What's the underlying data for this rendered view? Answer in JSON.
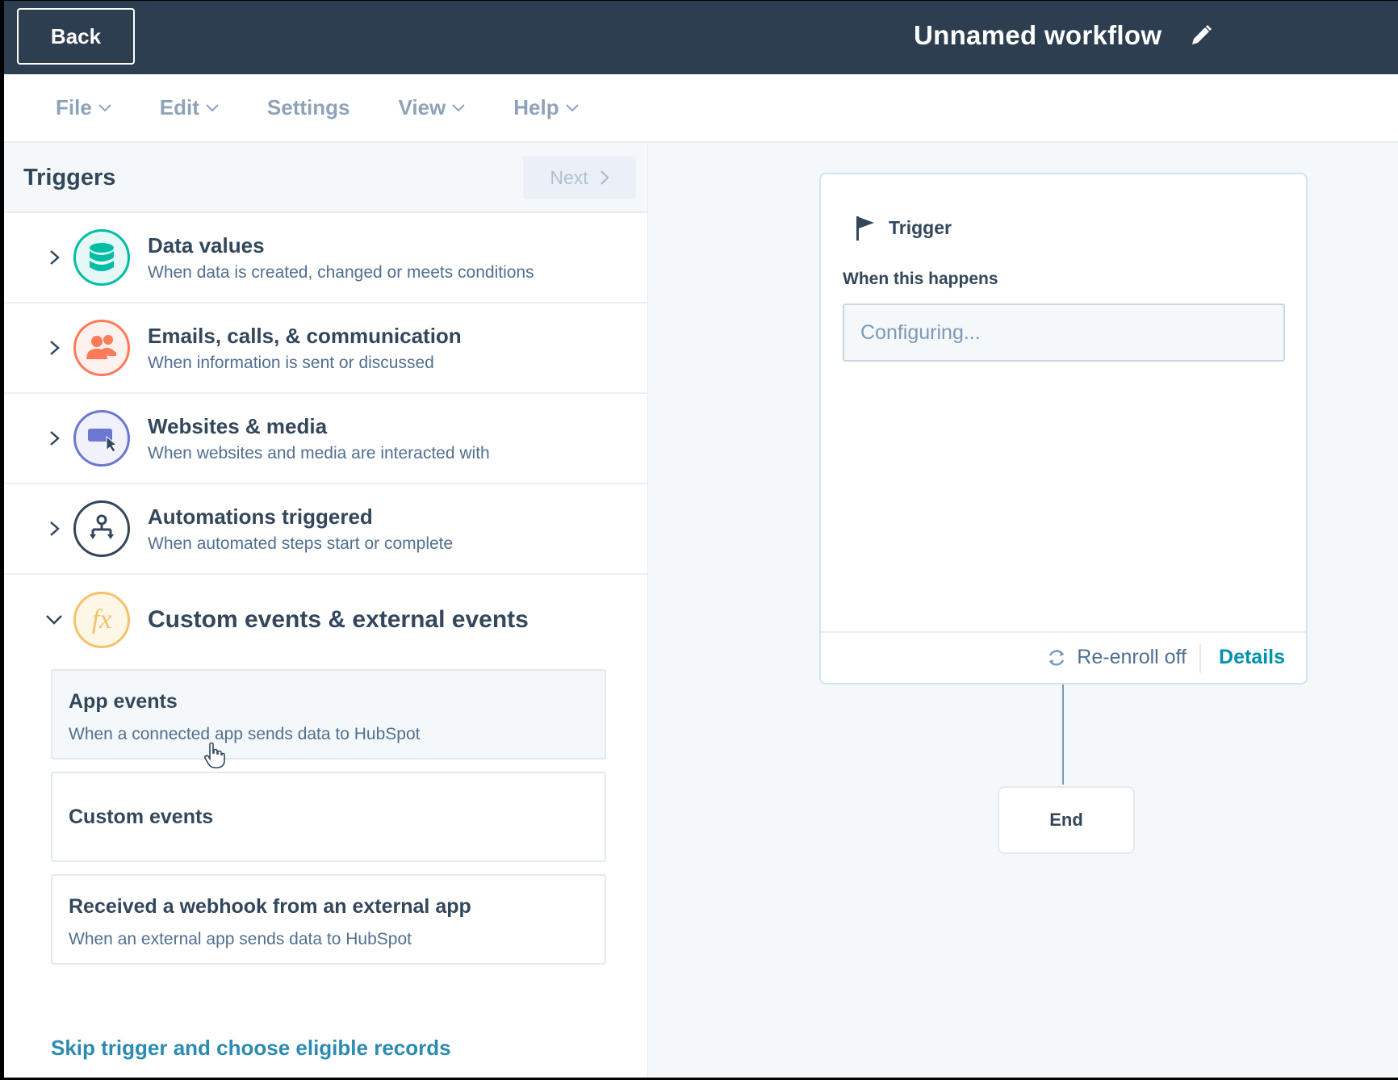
{
  "header": {
    "back_label": "Back",
    "workflow_title": "Unnamed workflow",
    "edit_icon": "pencil-icon"
  },
  "menu": {
    "items": [
      {
        "label": "File",
        "has_dropdown": true
      },
      {
        "label": "Edit",
        "has_dropdown": true
      },
      {
        "label": "Settings",
        "has_dropdown": false
      },
      {
        "label": "View",
        "has_dropdown": true
      },
      {
        "label": "Help",
        "has_dropdown": true
      }
    ]
  },
  "panel": {
    "title": "Triggers",
    "next_label": "Next",
    "categories": [
      {
        "title": "Data values",
        "desc": "When data is created, changed or meets conditions",
        "icon": "database-icon",
        "color": "#00bda5"
      },
      {
        "title": "Emails, calls, & communication",
        "desc": "When information is sent or discussed",
        "icon": "people-icon",
        "color": "#ff7a59"
      },
      {
        "title": "Websites & media",
        "desc": "When websites and media are interacted with",
        "icon": "web-click-icon",
        "color": "#6a78d1"
      },
      {
        "title": "Automations triggered",
        "desc": "When automated steps start or complete",
        "icon": "workflow-icon",
        "color": "#33475b"
      }
    ],
    "open_category": {
      "title": "Custom events & external events",
      "icon_text": "fx",
      "icon": "function-icon",
      "color": "#f5c26b"
    },
    "sub_items": [
      {
        "title": "App events",
        "desc": "When a connected app sends data to HubSpot"
      },
      {
        "title": "Custom events",
        "desc": ""
      },
      {
        "title": "Received a webhook from an external app",
        "desc": "When an external app sends data to HubSpot"
      }
    ],
    "skip_link": "Skip trigger and choose eligible records"
  },
  "canvas": {
    "trigger_label": "Trigger",
    "when_label": "When this happens",
    "config_text": "Configuring...",
    "reenroll_label": "Re-enroll off",
    "details_label": "Details",
    "end_label": "End"
  }
}
